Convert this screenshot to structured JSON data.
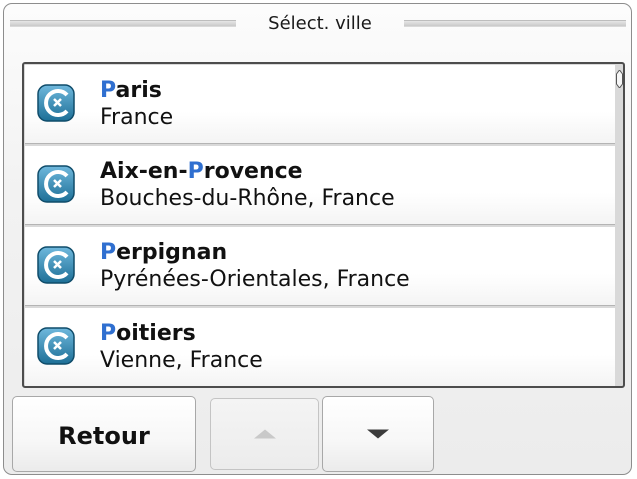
{
  "header": {
    "title": "Sélect. ville"
  },
  "results": [
    {
      "name_highlight": "P",
      "name_rest": "aris",
      "name_prefix": "",
      "subtitle": "France",
      "icon": "city-icon"
    },
    {
      "name_prefix": "Aix-en-",
      "name_highlight": "P",
      "name_rest": "rovence",
      "subtitle": "Bouches-du-Rhône, France",
      "icon": "city-icon"
    },
    {
      "name_prefix": "",
      "name_highlight": "P",
      "name_rest": "erpignan",
      "subtitle": "Pyrénées-Orientales, France",
      "icon": "city-icon"
    },
    {
      "name_prefix": "",
      "name_highlight": "P",
      "name_rest": "oitiers",
      "subtitle": "Vienne, France",
      "icon": "city-icon"
    }
  ],
  "footer": {
    "back_label": "Retour",
    "up_icon": "arrow-up-icon",
    "down_icon": "arrow-down-icon"
  },
  "colors": {
    "highlight": "#2f6fd0",
    "list_border": "#4d4d4d"
  }
}
